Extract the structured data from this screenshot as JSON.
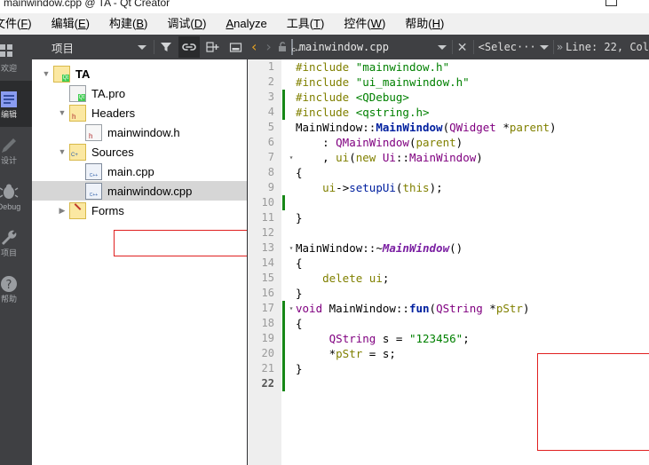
{
  "window": {
    "title": "mainwindow.cpp @ TA - Qt Creator",
    "maximize_label": "□"
  },
  "menubar": {
    "items": [
      {
        "label": "文件(F)",
        "mnemonic": "F"
      },
      {
        "label": "编辑(E)",
        "mnemonic": "E"
      },
      {
        "label": "构建(B)",
        "mnemonic": "B"
      },
      {
        "label": "调试(D)",
        "mnemonic": "D"
      },
      {
        "label": "Analyze",
        "mnemonic": "A"
      },
      {
        "label": "工具(T)",
        "mnemonic": "T"
      },
      {
        "label": "控件(W)",
        "mnemonic": "W"
      },
      {
        "label": "帮助(H)",
        "mnemonic": "H"
      }
    ]
  },
  "modebar": {
    "items": [
      {
        "name": "welcome",
        "label": "欢迎",
        "icon": "grid-icon",
        "selected": false
      },
      {
        "name": "edit",
        "label": "编辑",
        "icon": "document-icon",
        "selected": true
      },
      {
        "name": "design",
        "label": "设计",
        "icon": "pencil-icon",
        "selected": false
      },
      {
        "name": "debug",
        "label": "Debug",
        "icon": "bug-icon",
        "selected": false
      },
      {
        "name": "projects",
        "label": "项目",
        "icon": "wrench-icon",
        "selected": false
      },
      {
        "name": "help",
        "label": "帮助",
        "icon": "help-icon",
        "selected": false
      }
    ]
  },
  "project_toolbar": {
    "combo_value": "项目",
    "buttons": [
      {
        "name": "filter-button",
        "icon": "filter-icon",
        "active": false
      },
      {
        "name": "sync-button",
        "icon": "link-icon",
        "active": true
      },
      {
        "name": "split-button",
        "icon": "split-add-icon",
        "active": false
      },
      {
        "name": "collapse-button",
        "icon": "minimize-icon",
        "active": false
      }
    ]
  },
  "editor_toolbar": {
    "back_arrow": "‹",
    "forward_arrow": "›",
    "lock_icon": "unlocked-icon",
    "file_icon": "cpp-file-icon",
    "filename": "mainwindow.cpp",
    "close_label": "✕",
    "symbol_selector": "<Selec···",
    "position": "Line: 22, Col"
  },
  "project_tree": {
    "rows": [
      {
        "label": "TA",
        "indent": 0,
        "twisty": "open",
        "icon": "qt-project-icon",
        "bold": true,
        "selected": false
      },
      {
        "label": "TA.pro",
        "indent": 1,
        "twisty": "none",
        "icon": "pro-file-icon",
        "bold": false,
        "selected": false
      },
      {
        "label": "Headers",
        "indent": 1,
        "twisty": "open",
        "icon": "headers-folder-icon",
        "bold": false,
        "selected": false
      },
      {
        "label": "mainwindow.h",
        "indent": 2,
        "twisty": "none",
        "icon": "h-file-icon",
        "bold": false,
        "selected": false
      },
      {
        "label": "Sources",
        "indent": 1,
        "twisty": "open",
        "icon": "sources-folder-icon",
        "bold": false,
        "selected": false
      },
      {
        "label": "main.cpp",
        "indent": 2,
        "twisty": "none",
        "icon": "cpp-file-icon",
        "bold": false,
        "selected": false
      },
      {
        "label": "mainwindow.cpp",
        "indent": 2,
        "twisty": "none",
        "icon": "cpp-file-icon",
        "bold": false,
        "selected": true
      },
      {
        "label": "Forms",
        "indent": 1,
        "twisty": "closed",
        "icon": "forms-folder-icon",
        "bold": false,
        "selected": false
      }
    ]
  },
  "code": {
    "current_line": 22,
    "lines": [
      {
        "n": 1,
        "changed": false,
        "fold": "",
        "tokens": [
          {
            "t": "#include ",
            "c": "t-pre"
          },
          {
            "t": "\"mainwindow.h\"",
            "c": "t-str"
          }
        ]
      },
      {
        "n": 2,
        "changed": false,
        "fold": "",
        "tokens": [
          {
            "t": "#include ",
            "c": "t-pre"
          },
          {
            "t": "\"ui_mainwindow.h\"",
            "c": "t-str"
          }
        ]
      },
      {
        "n": 3,
        "changed": true,
        "fold": "",
        "tokens": [
          {
            "t": "#include ",
            "c": "t-pre"
          },
          {
            "t": "<QDebug>",
            "c": "t-ang"
          }
        ]
      },
      {
        "n": 4,
        "changed": true,
        "fold": "",
        "tokens": [
          {
            "t": "#include ",
            "c": "t-pre"
          },
          {
            "t": "<qstring.h>",
            "c": "t-ang"
          }
        ]
      },
      {
        "n": 5,
        "changed": false,
        "fold": "",
        "tokens": [
          {
            "t": "MainWindow",
            "c": "t-cls"
          },
          {
            "t": "::",
            "c": "t-pl"
          },
          {
            "t": "MainWindow",
            "c": "t-fnb"
          },
          {
            "t": "(",
            "c": "t-pl"
          },
          {
            "t": "QWidget",
            "c": "t-typ"
          },
          {
            "t": " *",
            "c": "t-pl"
          },
          {
            "t": "parent",
            "c": "t-var"
          },
          {
            "t": ")",
            "c": "t-pl"
          }
        ]
      },
      {
        "n": 6,
        "changed": false,
        "fold": "",
        "tokens": [
          {
            "t": "    : ",
            "c": "t-pl"
          },
          {
            "t": "QMainWindow",
            "c": "t-typ"
          },
          {
            "t": "(",
            "c": "t-pl"
          },
          {
            "t": "parent",
            "c": "t-var"
          },
          {
            "t": ")",
            "c": "t-pl"
          }
        ]
      },
      {
        "n": 7,
        "changed": false,
        "fold": "▾",
        "tokens": [
          {
            "t": "    , ",
            "c": "t-pl"
          },
          {
            "t": "ui",
            "c": "t-var"
          },
          {
            "t": "(",
            "c": "t-pl"
          },
          {
            "t": "new",
            "c": "t-kw"
          },
          {
            "t": " ",
            "c": "t-pl"
          },
          {
            "t": "Ui",
            "c": "t-typ"
          },
          {
            "t": "::",
            "c": "t-pl"
          },
          {
            "t": "MainWindow",
            "c": "t-typ"
          },
          {
            "t": ")",
            "c": "t-pl"
          }
        ]
      },
      {
        "n": 8,
        "changed": false,
        "fold": "",
        "tokens": [
          {
            "t": "{",
            "c": "t-pl"
          }
        ]
      },
      {
        "n": 9,
        "changed": false,
        "fold": "",
        "tokens": [
          {
            "t": "    ",
            "c": "t-pl"
          },
          {
            "t": "ui",
            "c": "t-var"
          },
          {
            "t": "->",
            "c": "t-pl"
          },
          {
            "t": "setupUi",
            "c": "t-fn"
          },
          {
            "t": "(",
            "c": "t-pl"
          },
          {
            "t": "this",
            "c": "t-kw"
          },
          {
            "t": ");",
            "c": "t-pl"
          }
        ]
      },
      {
        "n": 10,
        "changed": true,
        "fold": "",
        "tokens": [
          {
            "t": "",
            "c": "t-pl"
          }
        ]
      },
      {
        "n": 11,
        "changed": false,
        "fold": "",
        "tokens": [
          {
            "t": "}",
            "c": "t-pl"
          }
        ]
      },
      {
        "n": 12,
        "changed": false,
        "fold": "",
        "tokens": [
          {
            "t": "",
            "c": "t-pl"
          }
        ]
      },
      {
        "n": 13,
        "changed": false,
        "fold": "▾",
        "tokens": [
          {
            "t": "MainWindow",
            "c": "t-cls"
          },
          {
            "t": "::~",
            "c": "t-pl"
          },
          {
            "t": "MainWindow",
            "c": "t-fni"
          },
          {
            "t": "()",
            "c": "t-pl"
          }
        ]
      },
      {
        "n": 14,
        "changed": false,
        "fold": "",
        "tokens": [
          {
            "t": "{",
            "c": "t-pl"
          }
        ]
      },
      {
        "n": 15,
        "changed": false,
        "fold": "",
        "tokens": [
          {
            "t": "    ",
            "c": "t-pl"
          },
          {
            "t": "delete",
            "c": "t-kw"
          },
          {
            "t": " ",
            "c": "t-pl"
          },
          {
            "t": "ui",
            "c": "t-var"
          },
          {
            "t": ";",
            "c": "t-pl"
          }
        ]
      },
      {
        "n": 16,
        "changed": false,
        "fold": "",
        "tokens": [
          {
            "t": "}",
            "c": "t-pl"
          }
        ]
      },
      {
        "n": 17,
        "changed": true,
        "fold": "▾",
        "tokens": [
          {
            "t": "void",
            "c": "t-typ"
          },
          {
            "t": " ",
            "c": "t-pl"
          },
          {
            "t": "MainWindow",
            "c": "t-cls"
          },
          {
            "t": "::",
            "c": "t-pl"
          },
          {
            "t": "fun",
            "c": "t-fnb"
          },
          {
            "t": "(",
            "c": "t-pl"
          },
          {
            "t": "QString",
            "c": "t-typ"
          },
          {
            "t": " *",
            "c": "t-pl"
          },
          {
            "t": "pStr",
            "c": "t-var"
          },
          {
            "t": ")",
            "c": "t-pl"
          }
        ]
      },
      {
        "n": 18,
        "changed": true,
        "fold": "",
        "tokens": [
          {
            "t": "{",
            "c": "t-pl"
          }
        ]
      },
      {
        "n": 19,
        "changed": true,
        "fold": "",
        "tokens": [
          {
            "t": "     ",
            "c": "t-pl"
          },
          {
            "t": "QString",
            "c": "t-typ"
          },
          {
            "t": " ",
            "c": "t-pl"
          },
          {
            "t": "s",
            "c": "t-pl"
          },
          {
            "t": " = ",
            "c": "t-pl"
          },
          {
            "t": "\"123456\"",
            "c": "t-str"
          },
          {
            "t": ";",
            "c": "t-pl"
          }
        ]
      },
      {
        "n": 20,
        "changed": true,
        "fold": "",
        "tokens": [
          {
            "t": "     *",
            "c": "t-pl"
          },
          {
            "t": "pStr",
            "c": "t-var"
          },
          {
            "t": " = ",
            "c": "t-pl"
          },
          {
            "t": "s",
            "c": "t-pl"
          },
          {
            "t": ";",
            "c": "t-pl"
          }
        ]
      },
      {
        "n": 21,
        "changed": true,
        "fold": "",
        "tokens": [
          {
            "t": "}",
            "c": "t-pl"
          }
        ]
      },
      {
        "n": 22,
        "changed": true,
        "fold": "",
        "tokens": [
          {
            "t": "",
            "c": "t-pl"
          }
        ]
      }
    ]
  },
  "annotations": {
    "tree_highlight_color": "#e02020",
    "code_highlight_color": "#e02020"
  },
  "colors": {
    "toolbar_bg": "#3f4043",
    "modebar_bg": "#3f4043",
    "gutter_bg": "#eeeeee",
    "change_marker": "#168716",
    "selection_bg": "#d6d6d6"
  }
}
